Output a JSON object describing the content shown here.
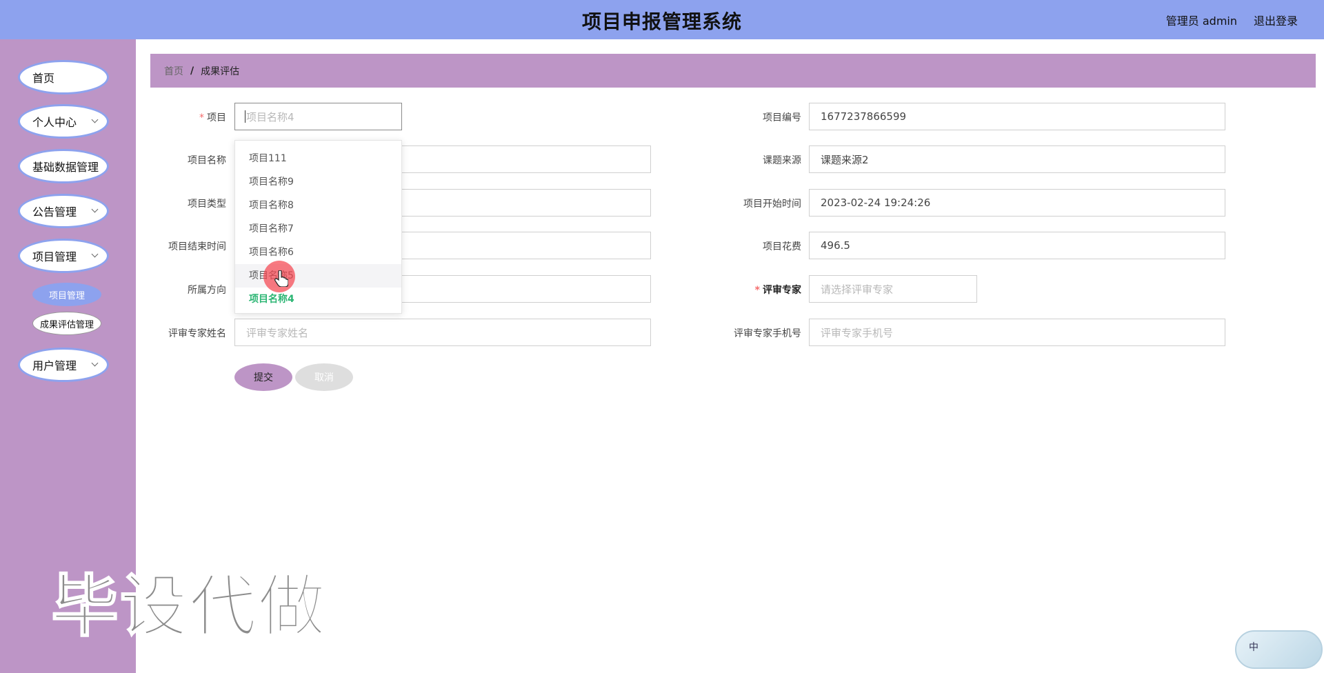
{
  "header": {
    "title": "项目申报管理系统",
    "user": "管理员 admin",
    "logout": "退出登录"
  },
  "sidebar": {
    "items": [
      {
        "label": "首页",
        "has_children": false
      },
      {
        "label": "个人中心",
        "has_children": true
      },
      {
        "label": "基础数据管理",
        "has_children": false
      },
      {
        "label": "公告管理",
        "has_children": true
      },
      {
        "label": "项目管理",
        "has_children": true
      },
      {
        "label": "用户管理",
        "has_children": true
      }
    ],
    "sub_items": [
      {
        "label": "项目管理",
        "active": true
      },
      {
        "label": "成果评估管理",
        "active": false
      }
    ]
  },
  "breadcrumb": {
    "home": "首页",
    "separator": "/",
    "current": "成果评估"
  },
  "form": {
    "project": {
      "label": "项目",
      "placeholder": "项目名称4"
    },
    "project_no": {
      "label": "项目编号",
      "value": "1677237866599"
    },
    "project_name": {
      "label": "项目名称"
    },
    "topic_source": {
      "label": "课题来源",
      "value": "课题来源2"
    },
    "project_type": {
      "label": "项目类型"
    },
    "start_time": {
      "label": "项目开始时间",
      "value": "2023-02-24 19:24:26"
    },
    "end_time": {
      "label": "项目结束时间"
    },
    "cost": {
      "label": "项目花费",
      "value": "496.5"
    },
    "direction": {
      "label": "所属方向"
    },
    "expert": {
      "label": "评审专家",
      "placeholder": "请选择评审专家"
    },
    "expert_name": {
      "label": "评审专家姓名",
      "placeholder": "评审专家姓名"
    },
    "expert_phone": {
      "label": "评审专家手机号",
      "placeholder": "评审专家手机号"
    },
    "submit": "提交",
    "cancel": "取消"
  },
  "dropdown": {
    "options": [
      "项目111",
      "项目名称9",
      "项目名称8",
      "项目名称7",
      "项目名称6",
      "项目名称5",
      "项目名称4"
    ],
    "hovered": "项目名称5",
    "selected": "项目名称4"
  },
  "watermark": "毕设代做",
  "widget": {
    "text": "中"
  },
  "colors": {
    "header_bg": "#8da2ee",
    "sidebar_bg": "#bd95c6",
    "selected_option": "#2bb573",
    "required_mark": "#f56c6c"
  }
}
